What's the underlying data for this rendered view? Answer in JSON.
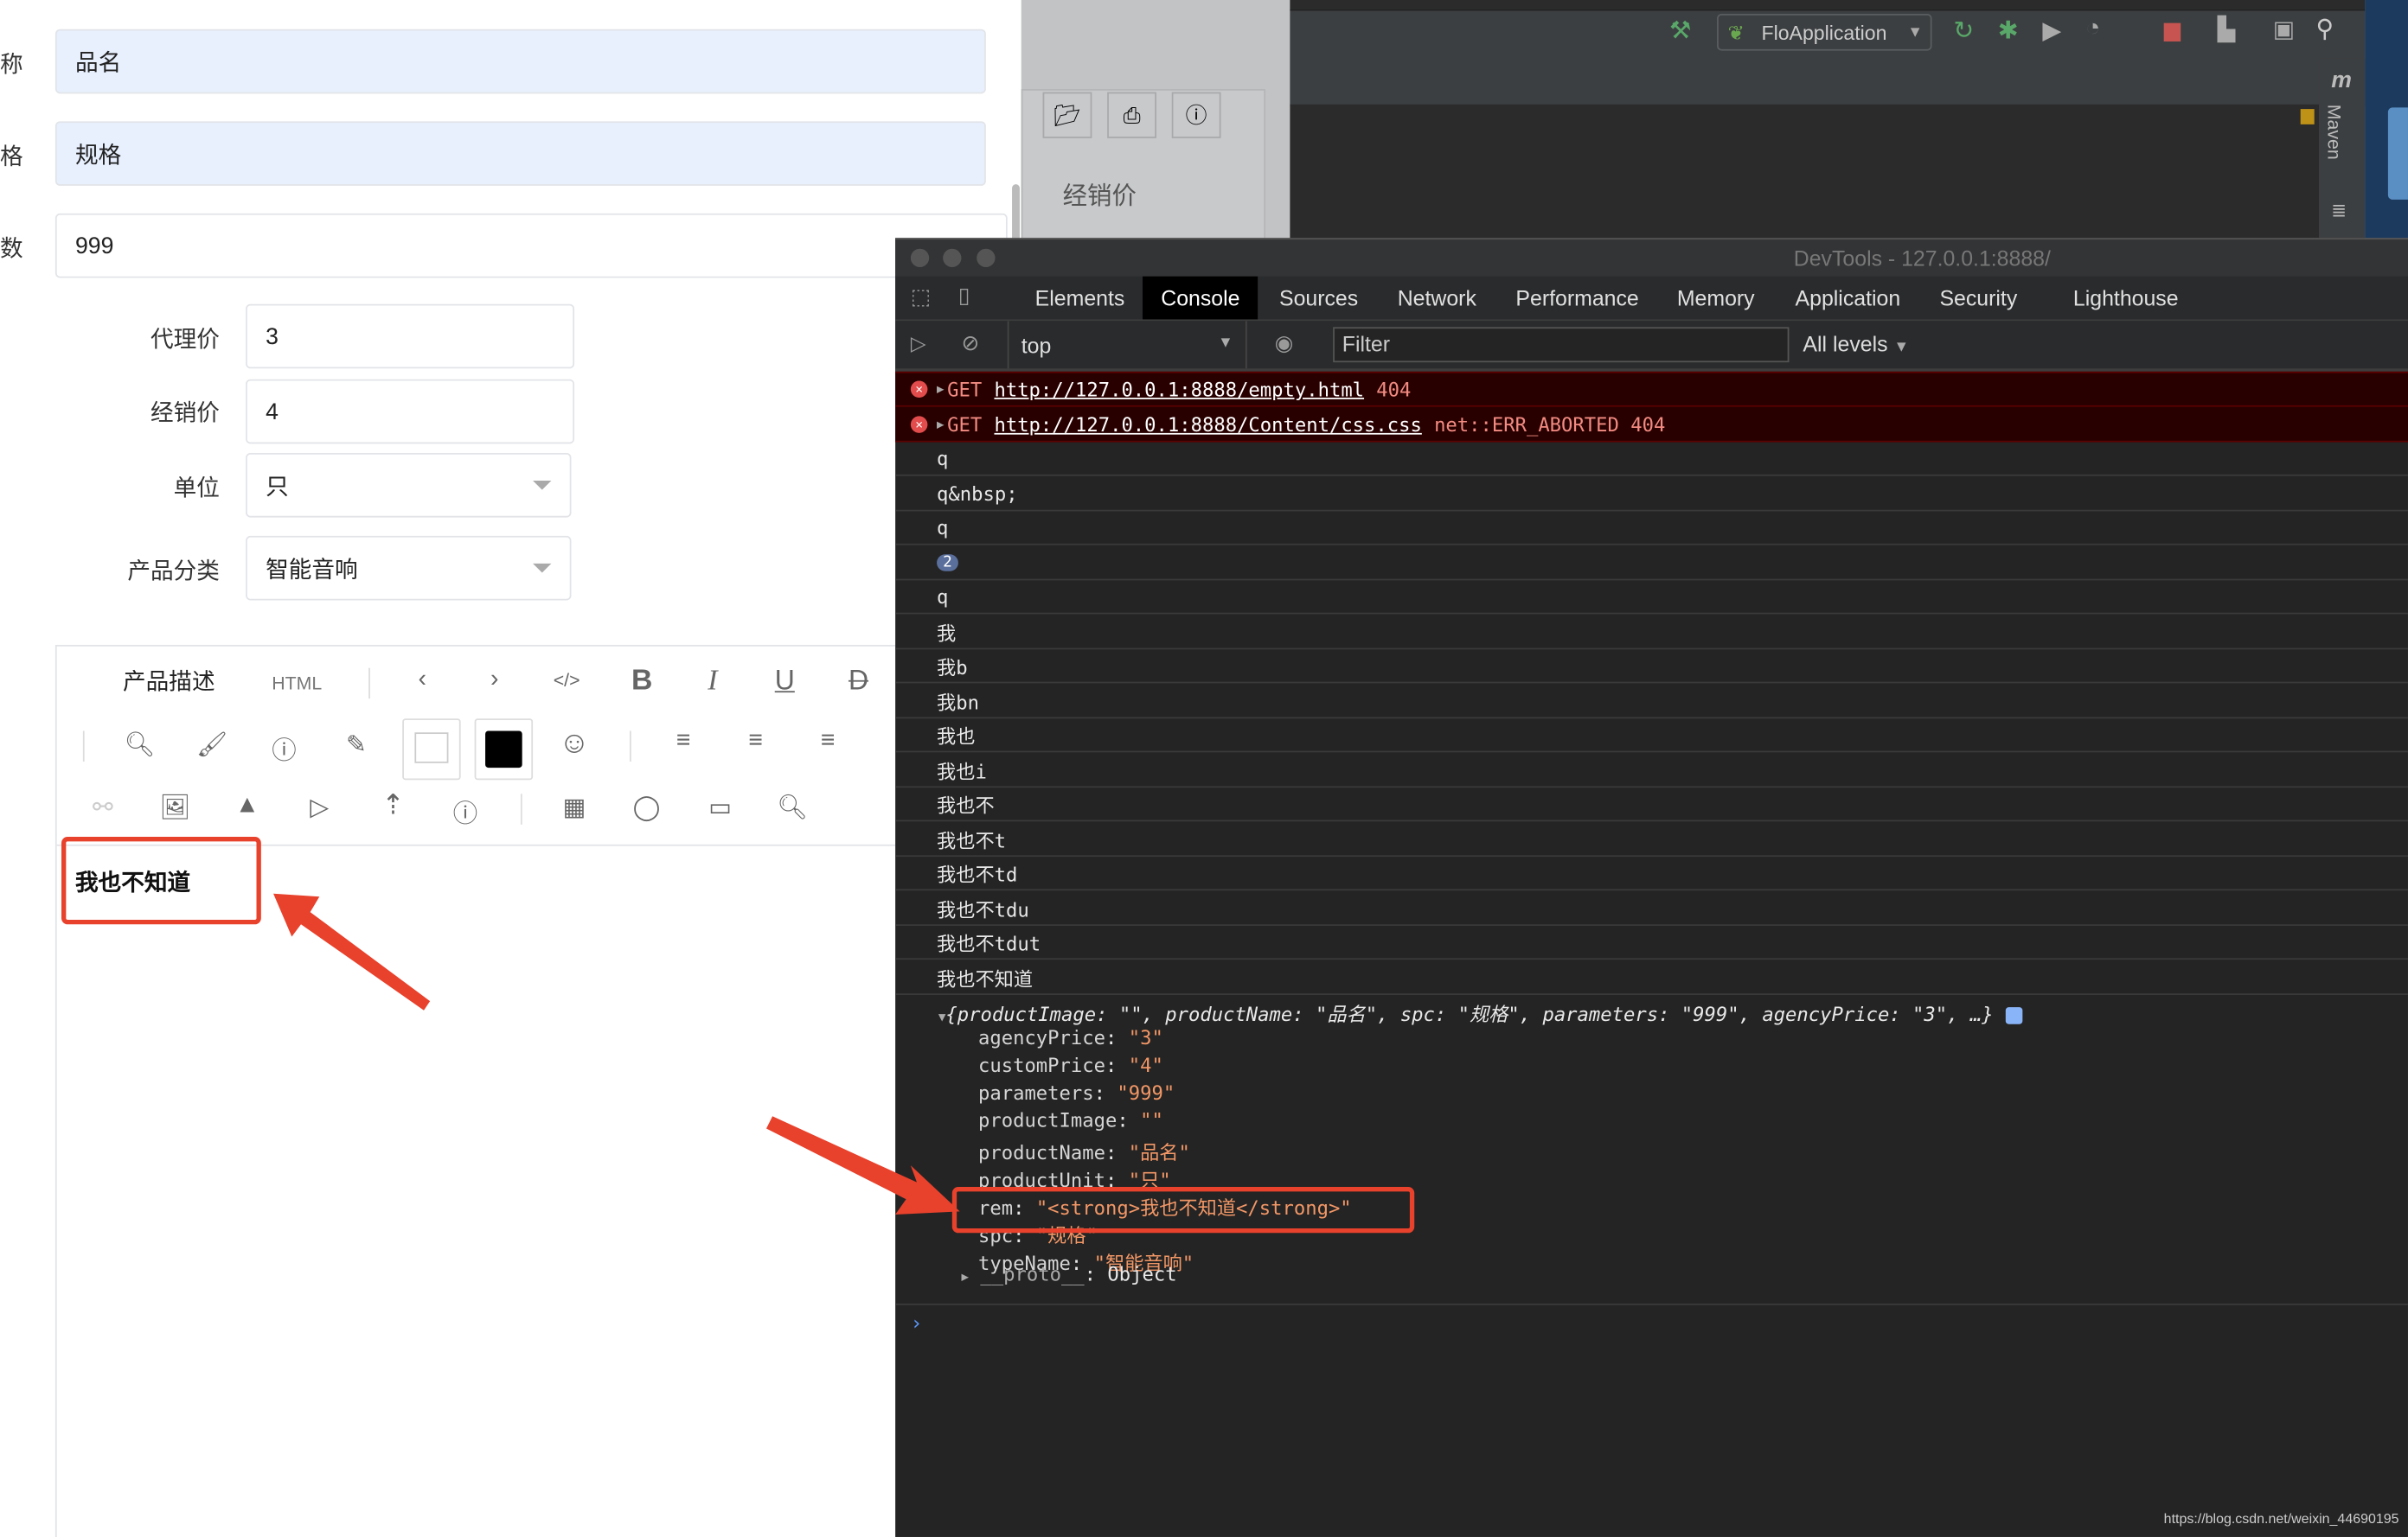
{
  "form": {
    "cut_labels": [
      "称",
      "格",
      "数"
    ],
    "product_name": "品名",
    "spec": "规格",
    "parameters": "999",
    "agency_price_label": "代理价",
    "agency_price": "3",
    "custom_price_label": "经销价",
    "custom_price": "4",
    "unit_label": "单位",
    "unit": "只",
    "category_label": "产品分类",
    "category": "智能音响",
    "editor_label": "产品描述",
    "html_button": "HTML",
    "editor_content": "我也不知道"
  },
  "background_panel": {
    "label": "经销价"
  },
  "ide": {
    "run_config": "FloApplication",
    "maven_label": "Maven"
  },
  "devtools": {
    "title": "DevTools - 127.0.0.1:8888/",
    "tabs": [
      "Elements",
      "Console",
      "Sources",
      "Network",
      "Performance",
      "Memory",
      "Application",
      "Security",
      "Lighthouse"
    ],
    "active_tab": "Console",
    "context": "top",
    "filter_placeholder": "Filter",
    "levels": "All levels",
    "errors": [
      {
        "method": "GET",
        "url": "http://127.0.0.1:8888/empty.html",
        "detail": "404"
      },
      {
        "method": "GET",
        "url": "http://127.0.0.1:8888/Content/css.css",
        "detail": "net::ERR_ABORTED 404"
      }
    ],
    "logs": [
      "q",
      "q&nbsp;",
      "q",
      "2",
      "q",
      "我",
      "我b",
      "我bn",
      "我也",
      "我也i",
      "我也不",
      "我也不t",
      "我也不td",
      "我也不tdu",
      "我也不tdut",
      "我也不知道"
    ],
    "object_summary": "{productImage: \"\", productName: \"品名\", spc: \"规格\", parameters: \"999\", agencyPrice: \"3\", …}",
    "object_props": [
      {
        "key": "agencyPrice",
        "value": "\"3\""
      },
      {
        "key": "customPrice",
        "value": "\"4\""
      },
      {
        "key": "parameters",
        "value": "\"999\""
      },
      {
        "key": "productImage",
        "value": "\"\""
      },
      {
        "key": "productName",
        "value": "\"品名\""
      },
      {
        "key": "productUnit",
        "value": "\"只\""
      },
      {
        "key": "rem",
        "value": "\"<strong>我也不知道</strong>\""
      },
      {
        "key": "spc",
        "value": "\"规格\""
      },
      {
        "key": "typeName",
        "value": "\"智能音响\""
      }
    ],
    "proto": "__proto__",
    "proto_value": "Object"
  },
  "watermark": "https://blog.csdn.net/weixin_44690195",
  "colors": {
    "highlight": "#e8412c",
    "error_bg": "#290000",
    "string": "#f29766",
    "autofill": "#e8f0fe"
  }
}
